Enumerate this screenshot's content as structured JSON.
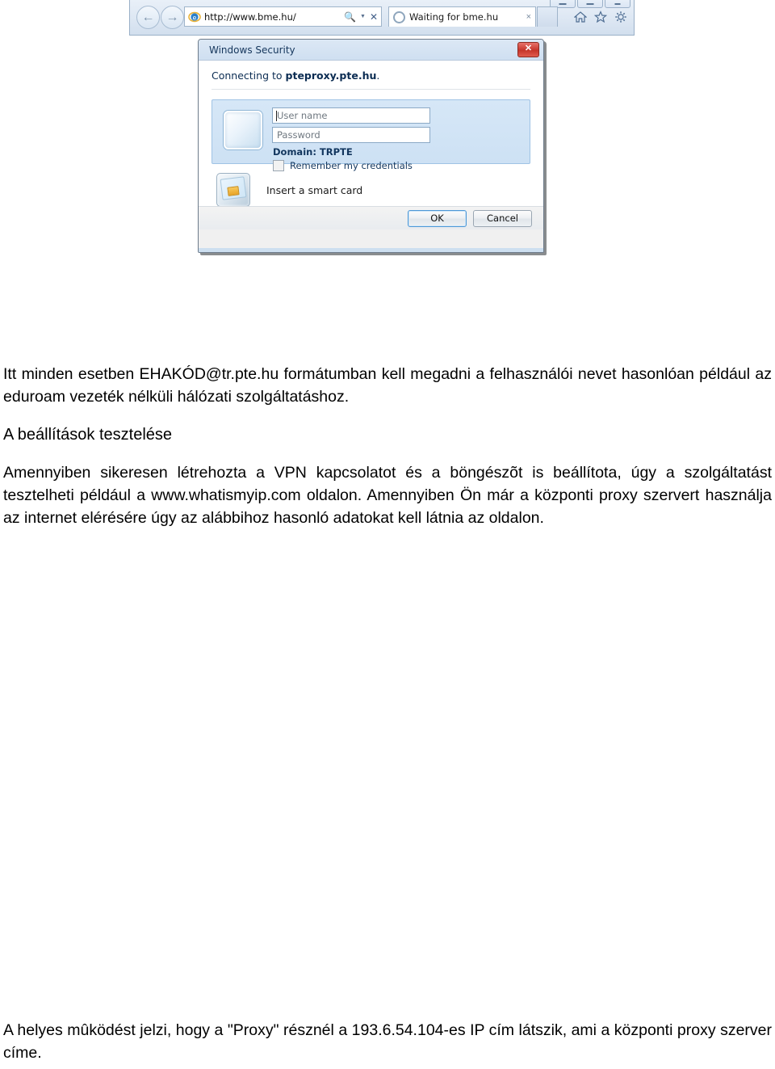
{
  "figure": {
    "browser": {
      "back_icon": "back-arrow-icon",
      "forward_icon": "forward-arrow-icon",
      "address_value": "http://www.bme.hu/",
      "address_placeholder": "http://www.bme.hu/",
      "search_icon": "search-magnifier-icon",
      "dropdown_icon": "chevron-down-icon",
      "stop_icon": "stop-x-icon",
      "tab_title": "Waiting for bme.hu",
      "tab_close_label": "×",
      "home_icon": "home-icon",
      "favorites_icon": "star-icon",
      "settings_icon": "gear-icon",
      "window_controls": [
        "minimize",
        "maximize",
        "close"
      ]
    },
    "dialog": {
      "title": "Windows Security",
      "close_label": "✖",
      "heading_prefix": "Connecting to ",
      "heading_host": "pteproxy.pte.hu",
      "heading_suffix": ".",
      "user_tile_icon": "user-tile-icon",
      "username_placeholder": "User name",
      "username_value": "",
      "password_placeholder": "Password",
      "password_value": "",
      "domain_label": "Domain: TRPTE",
      "remember_label": "Remember my credentials",
      "remember_checked": false,
      "smartcard_icon": "smart-card-icon",
      "smartcard_label": "Insert a smart card",
      "ok_label": "OK",
      "cancel_label": "Cancel"
    }
  },
  "document": {
    "paragraph_1": "Itt minden esetben EHAKÓD@tr.pte.hu formátumban kell megadni a felhasználói nevet hasonlóan például az eduroam vezeték nélküli hálózati szolgáltatáshoz.",
    "section_heading": "A beállítások tesztelése",
    "paragraph_2": "Amennyiben sikeresen létrehozta a VPN kapcsolatot és a böngészõt is beállítota, úgy a szolgáltatást tesztelheti például a www.whatismyip.com oldalon. Amennyiben Ön már a központi proxy szervert használja az internet elérésére úgy az alábbihoz hasonló adatokat kell látnia az oldalon.",
    "bottom_note": "A helyes mûködést jelzi, hogy a \"Proxy\" résznél a 193.6.54.104-es IP cím látszik, ami a központi proxy szerver címe."
  },
  "colors": {
    "dialog_titlebar": "#dce8f5",
    "credential_panel": "#cde1f4",
    "close_button_red": "#c5352b",
    "default_button_border": "#4d97d6"
  }
}
